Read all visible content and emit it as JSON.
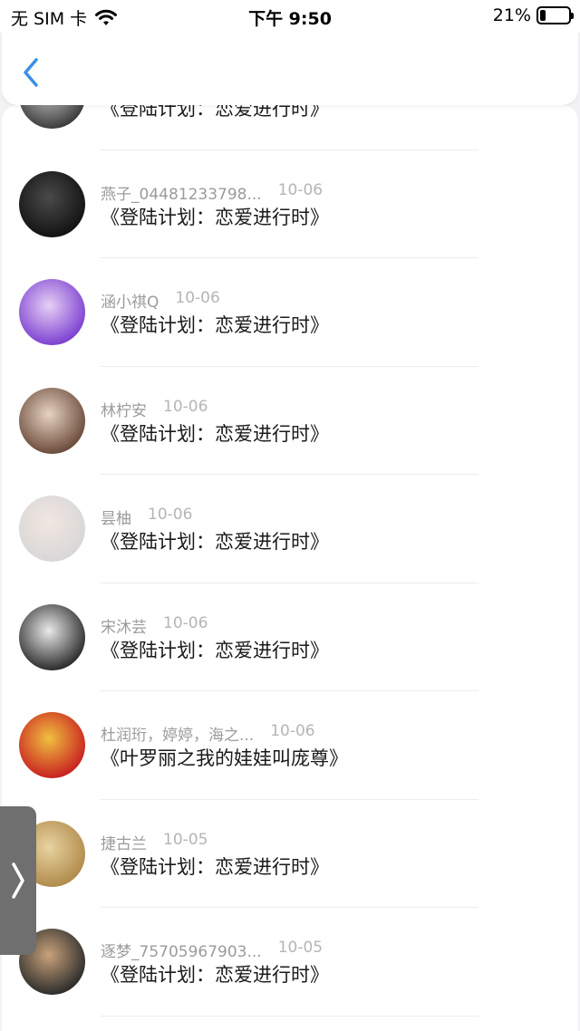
{
  "status_bar": {
    "carrier": "无 SIM 卡",
    "time": "下午 9:50",
    "battery_percent": "21%",
    "battery_level": 0.21
  },
  "nav": {
    "back_icon": "chevron-left-icon",
    "accent": "#3b8fe6"
  },
  "list": [
    {
      "name": "",
      "date": "",
      "title": "《登陆计划：恋爱进行时》",
      "avatar_colors": [
        "#3a3a3a",
        "#cfcfcf"
      ]
    },
    {
      "name": "燕子_04481233798...",
      "date": "10-06",
      "title": "《登陆计划：恋爱进行时》",
      "avatar_colors": [
        "#121212",
        "#4a4a4a"
      ]
    },
    {
      "name": "涵小祺Q",
      "date": "10-06",
      "title": "《登陆计划：恋爱进行时》",
      "avatar_colors": [
        "#7b3fd0",
        "#e7d0f5"
      ]
    },
    {
      "name": "林柠安",
      "date": "10-06",
      "title": "《登陆计划：恋爱进行时》",
      "avatar_colors": [
        "#6a4a3a",
        "#e6d2c2"
      ]
    },
    {
      "name": "昙柚",
      "date": "10-06",
      "title": "《登陆计划：恋爱进行时》",
      "avatar_colors": [
        "#d7d7d7",
        "#f2e6e0"
      ]
    },
    {
      "name": "宋沐芸",
      "date": "10-06",
      "title": "《登陆计划：恋爱进行时》",
      "avatar_colors": [
        "#2a2a2a",
        "#eaeaea"
      ]
    },
    {
      "name": "杜润珩，婷婷，海之...",
      "date": "10-06",
      "title": "《叶罗丽之我的娃娃叫庞尊》",
      "avatar_colors": [
        "#c81f1f",
        "#f0c040"
      ]
    },
    {
      "name": "捷古兰",
      "date": "10-05",
      "title": "《登陆计划：恋爱进行时》",
      "avatar_colors": [
        "#b08a4a",
        "#e8d2a0"
      ]
    },
    {
      "name": "逐梦_75705967903...",
      "date": "10-05",
      "title": "《登陆计划：恋爱进行时》",
      "avatar_colors": [
        "#2b2b2b",
        "#c9a27a"
      ]
    }
  ],
  "side_handle": {
    "icon": "chevron-right-icon"
  }
}
